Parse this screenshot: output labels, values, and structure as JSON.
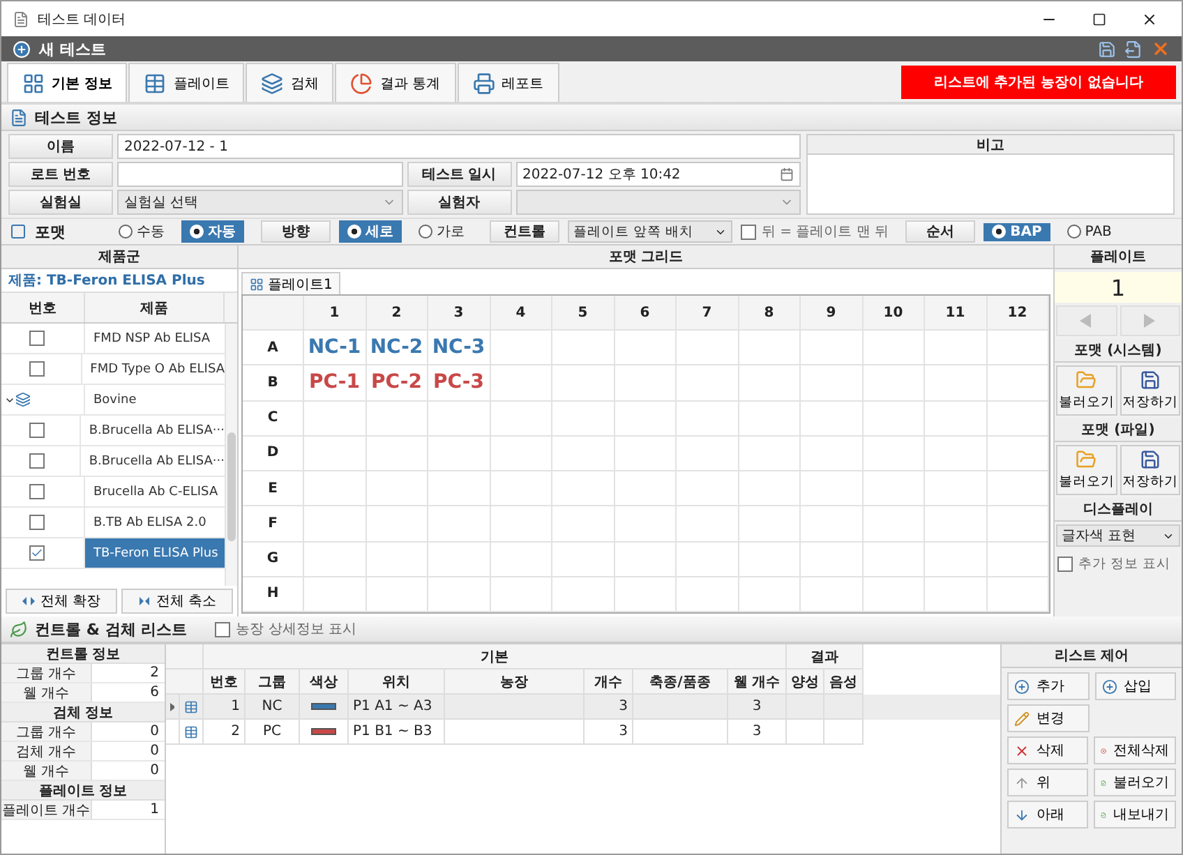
{
  "window": {
    "title": "테스트 데이터"
  },
  "header": {
    "title": "새 테스트"
  },
  "tabs": [
    {
      "label": "기본 정보",
      "selected": true
    },
    {
      "label": "플레이트",
      "selected": false
    },
    {
      "label": "검체",
      "selected": false
    },
    {
      "label": "결과 통계",
      "selected": false
    },
    {
      "label": "레포트",
      "selected": false
    }
  ],
  "alert": "리스트에 추가된 농장이 없습니다",
  "test_info": {
    "title": "테스트 정보",
    "name_label": "이름",
    "name_value": "2022-07-12 - 1",
    "lot_label": "로트 번호",
    "date_label": "테스트 일시",
    "date_value": "2022-07-12 오후 10:42",
    "lab_label": "실험실",
    "lab_value": "실험실 선택",
    "tester_label": "실험자",
    "note_label": "비고"
  },
  "format_bar": {
    "title": "포맷",
    "mode_options": [
      {
        "label": "수동",
        "selected": false
      },
      {
        "label": "자동",
        "selected": true
      }
    ],
    "direction_label": "방향",
    "direction_options": [
      {
        "label": "세로",
        "selected": true
      },
      {
        "label": "가로",
        "selected": false
      }
    ],
    "control_label": "컨트롤",
    "control_value": "플레이트 앞쪽 배치",
    "back_option": {
      "label": "뒤 = 플레이트 맨 뒤",
      "checked": false
    },
    "order_label": "순서",
    "order_options": [
      {
        "label": "BAP",
        "selected": true
      },
      {
        "label": "PAB",
        "selected": false
      }
    ]
  },
  "product_panel": {
    "title": "제품군",
    "current": "제품: TB-Feron ELISA Plus",
    "columns": [
      "번호",
      "제품"
    ],
    "tree": [
      {
        "kind": "item",
        "label": "FMD NSP Ab ELISA",
        "checked": false,
        "selected": false
      },
      {
        "kind": "item",
        "label": "FMD Type O Ab ELISA",
        "checked": false,
        "selected": false
      },
      {
        "kind": "group",
        "label": "Bovine",
        "expanded": true,
        "children": [
          {
            "kind": "item",
            "label": "B.Brucella Ab ELISA···",
            "checked": false,
            "selected": false
          },
          {
            "kind": "item",
            "label": "B.Brucella Ab ELISA···",
            "checked": false,
            "selected": false
          },
          {
            "kind": "item",
            "label": "Brucella Ab C-ELISA",
            "checked": false,
            "selected": false
          },
          {
            "kind": "item",
            "label": "B.TB Ab ELISA 2.0",
            "checked": false,
            "selected": false
          },
          {
            "kind": "item",
            "label": "TB-Feron ELISA Plus",
            "checked": true,
            "selected": true
          }
        ]
      }
    ],
    "buttons": [
      "전체 확장",
      "전체 축소"
    ]
  },
  "grid": {
    "title": "포맷 그리드",
    "tab": "플레이트1",
    "columns": [
      "1",
      "2",
      "3",
      "4",
      "5",
      "6",
      "7",
      "8",
      "9",
      "10",
      "11",
      "12"
    ],
    "rows": [
      {
        "label": "A",
        "cells": [
          {
            "text": "NC-1",
            "color": "#3a78b0"
          },
          {
            "text": "NC-2",
            "color": "#3a78b0"
          },
          {
            "text": "NC-3",
            "color": "#3a78b0"
          }
        ]
      },
      {
        "label": "B",
        "cells": [
          {
            "text": "PC-1",
            "color": "#c84848"
          },
          {
            "text": "PC-2",
            "color": "#c84848"
          },
          {
            "text": "PC-3",
            "color": "#c84848"
          }
        ]
      },
      {
        "label": "C",
        "cells": []
      },
      {
        "label": "D",
        "cells": []
      },
      {
        "label": "E",
        "cells": []
      },
      {
        "label": "F",
        "cells": []
      },
      {
        "label": "G",
        "cells": []
      },
      {
        "label": "H",
        "cells": []
      }
    ]
  },
  "plate_panel": {
    "title": "플레이트",
    "number": "1",
    "system_title": "포맷 (시스템)",
    "system_buttons": [
      "불러오기",
      "저장하기"
    ],
    "file_title": "포맷 (파일)",
    "file_buttons": [
      "불러오기",
      "저장하기"
    ],
    "display_title": "디스플레이",
    "display_value": "글자색 표현",
    "extra_info": {
      "label": "추가 정보 표시",
      "checked": false
    }
  },
  "list_section": {
    "title": "컨트롤 & 검체 리스트",
    "farm_detail": {
      "label": "농장 상세정보 표시",
      "checked": false
    }
  },
  "summary": [
    {
      "kind": "header",
      "label": "컨트롤 정보"
    },
    {
      "kind": "row",
      "label": "그룹 개수",
      "value": "2"
    },
    {
      "kind": "row",
      "label": "웰 개수",
      "value": "6"
    },
    {
      "kind": "header",
      "label": "검체 정보"
    },
    {
      "kind": "row",
      "label": "그룹 개수",
      "value": "0"
    },
    {
      "kind": "row",
      "label": "검체 개수",
      "value": "0"
    },
    {
      "kind": "row",
      "label": "웰 개수",
      "value": "0"
    },
    {
      "kind": "header",
      "label": "플레이트 정보"
    },
    {
      "kind": "row",
      "label": "플레이트 개수",
      "value": "1"
    }
  ],
  "table": {
    "group_headers": [
      "기본",
      "결과"
    ],
    "columns": [
      "번호",
      "그룹",
      "색상",
      "위치",
      "농장",
      "개수",
      "축종/품종",
      "웰 개수",
      "양성",
      "음성"
    ],
    "rows": [
      {
        "selected": true,
        "number": "1",
        "group": "NC",
        "color": "#3a78b0",
        "position": "P1 A1 ~ A3",
        "count": "3",
        "wells": "3"
      },
      {
        "selected": false,
        "number": "2",
        "group": "PC",
        "color": "#c84848",
        "position": "P1 B1 ~ B3",
        "count": "3",
        "wells": "3"
      }
    ]
  },
  "list_control": {
    "title": "리스트 제어",
    "rows": [
      [
        {
          "kind": "add",
          "label": "추가"
        },
        {
          "kind": "insert",
          "label": "삽입"
        }
      ],
      [
        {
          "kind": "edit",
          "label": "변경"
        }
      ],
      [
        {
          "kind": "delete",
          "label": "삭제"
        },
        {
          "kind": "delete_all",
          "label": "전체삭제"
        }
      ],
      [
        {
          "kind": "up",
          "label": "위"
        },
        {
          "kind": "import",
          "label": "불러오기"
        }
      ],
      [
        {
          "kind": "down",
          "label": "아래"
        },
        {
          "kind": "export",
          "label": "내보내기"
        }
      ]
    ]
  }
}
